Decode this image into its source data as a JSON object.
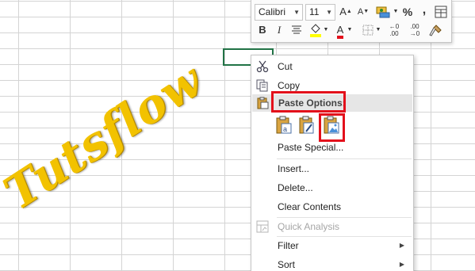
{
  "sheet": {
    "watermark": "Tutsflow"
  },
  "toolbar": {
    "font_name": "Calibri",
    "font_size": "11",
    "increase_font": "A",
    "decrease_font": "A",
    "percent": "%",
    "comma": ",",
    "bold": "B",
    "italic": "I",
    "font_color_letter": "A",
    "inc_decimal_top": "←0",
    "inc_decimal_bottom": ".00",
    "dec_decimal_top": ".00",
    "dec_decimal_bottom": "→0",
    "colors": {
      "highlight": "#ffff00",
      "font_color": "#e3101b"
    }
  },
  "menu": {
    "cut": "Cut",
    "copy": "Copy",
    "paste_options": "Paste Options:",
    "paste_special": "Paste Special...",
    "insert": "Insert...",
    "delete": "Delete...",
    "clear_contents": "Clear Contents",
    "quick_analysis": "Quick Analysis",
    "filter": "Filter",
    "sort": "Sort"
  },
  "colors": {
    "accent_highlight": "#e3101b",
    "selected_cell_border": "#217346"
  }
}
